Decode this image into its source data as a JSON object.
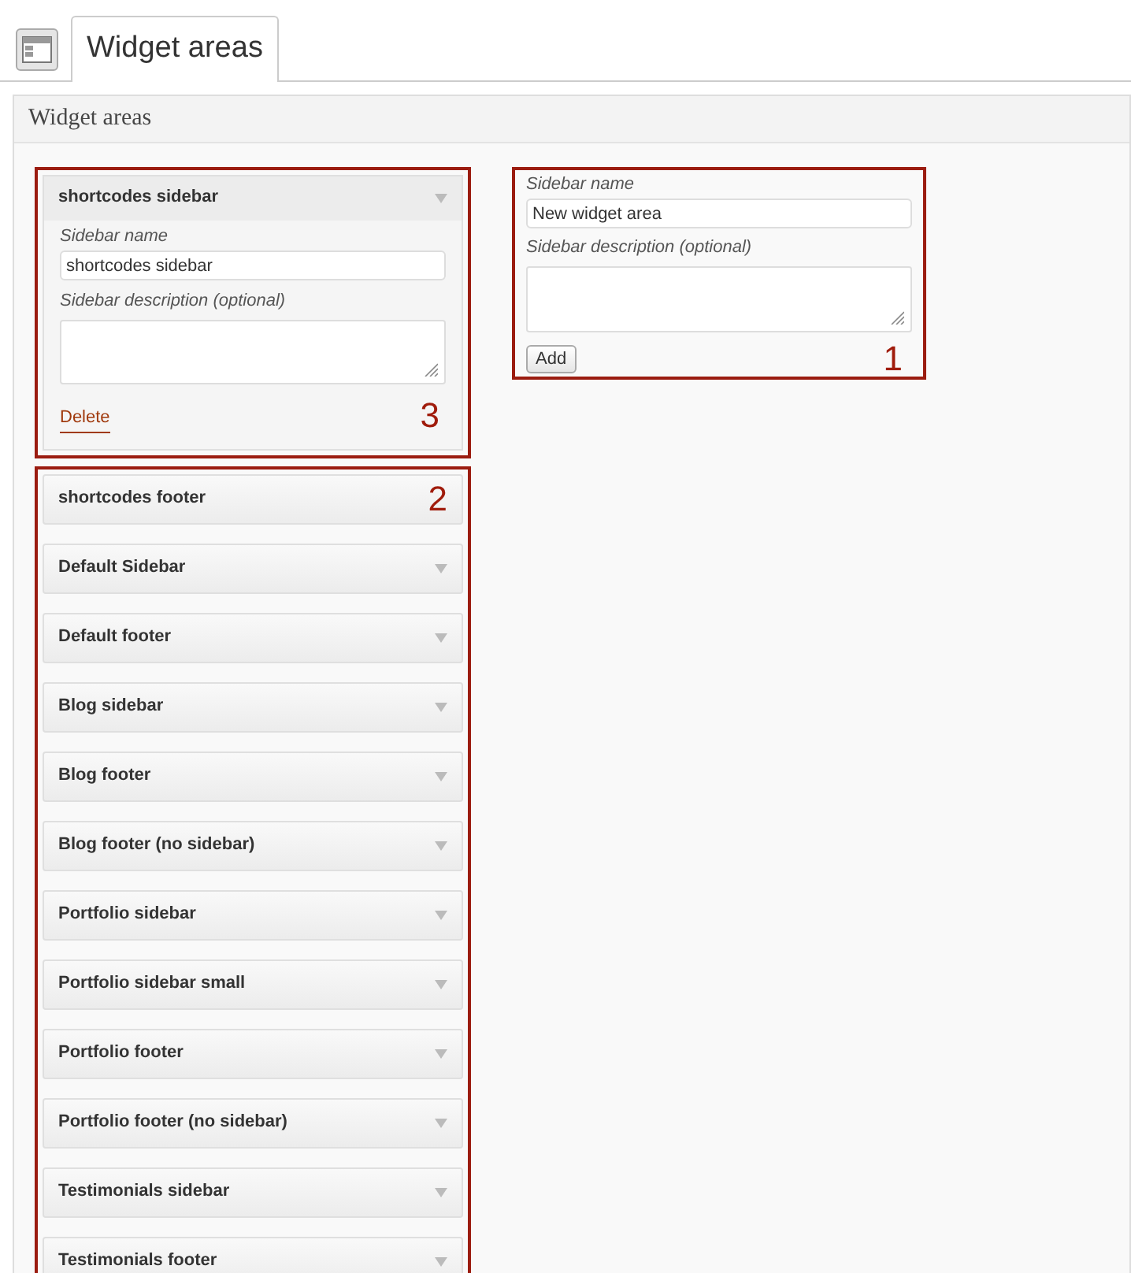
{
  "tab": {
    "label": "Widget areas",
    "selected": true
  },
  "panel": {
    "title": "Widget areas"
  },
  "open_area": {
    "title": "shortcodes sidebar",
    "name_label": "Sidebar name",
    "name_value": "shortcodes sidebar",
    "description_label": "Sidebar description (optional)",
    "delete_label": "Delete",
    "callout": "3"
  },
  "areas": {
    "callout": "2",
    "items": [
      {
        "title": "shortcodes footer",
        "caret": false
      },
      {
        "title": "Default Sidebar",
        "caret": true
      },
      {
        "title": "Default footer",
        "caret": true
      },
      {
        "title": "Blog sidebar",
        "caret": true
      },
      {
        "title": "Blog footer",
        "caret": true
      },
      {
        "title": "Blog footer (no sidebar)",
        "caret": true
      },
      {
        "title": "Portfolio sidebar",
        "caret": true
      },
      {
        "title": "Portfolio sidebar small",
        "caret": true
      },
      {
        "title": "Portfolio footer",
        "caret": true
      },
      {
        "title": "Portfolio footer (no sidebar)",
        "caret": true
      },
      {
        "title": "Testimonials sidebar",
        "caret": true
      },
      {
        "title": "Testimonials footer",
        "caret": true
      }
    ]
  },
  "new_area_form": {
    "name_label": "Sidebar name",
    "name_value": "New widget area",
    "description_label": "Sidebar description (optional)",
    "add_label": "Add",
    "callout": "1"
  }
}
